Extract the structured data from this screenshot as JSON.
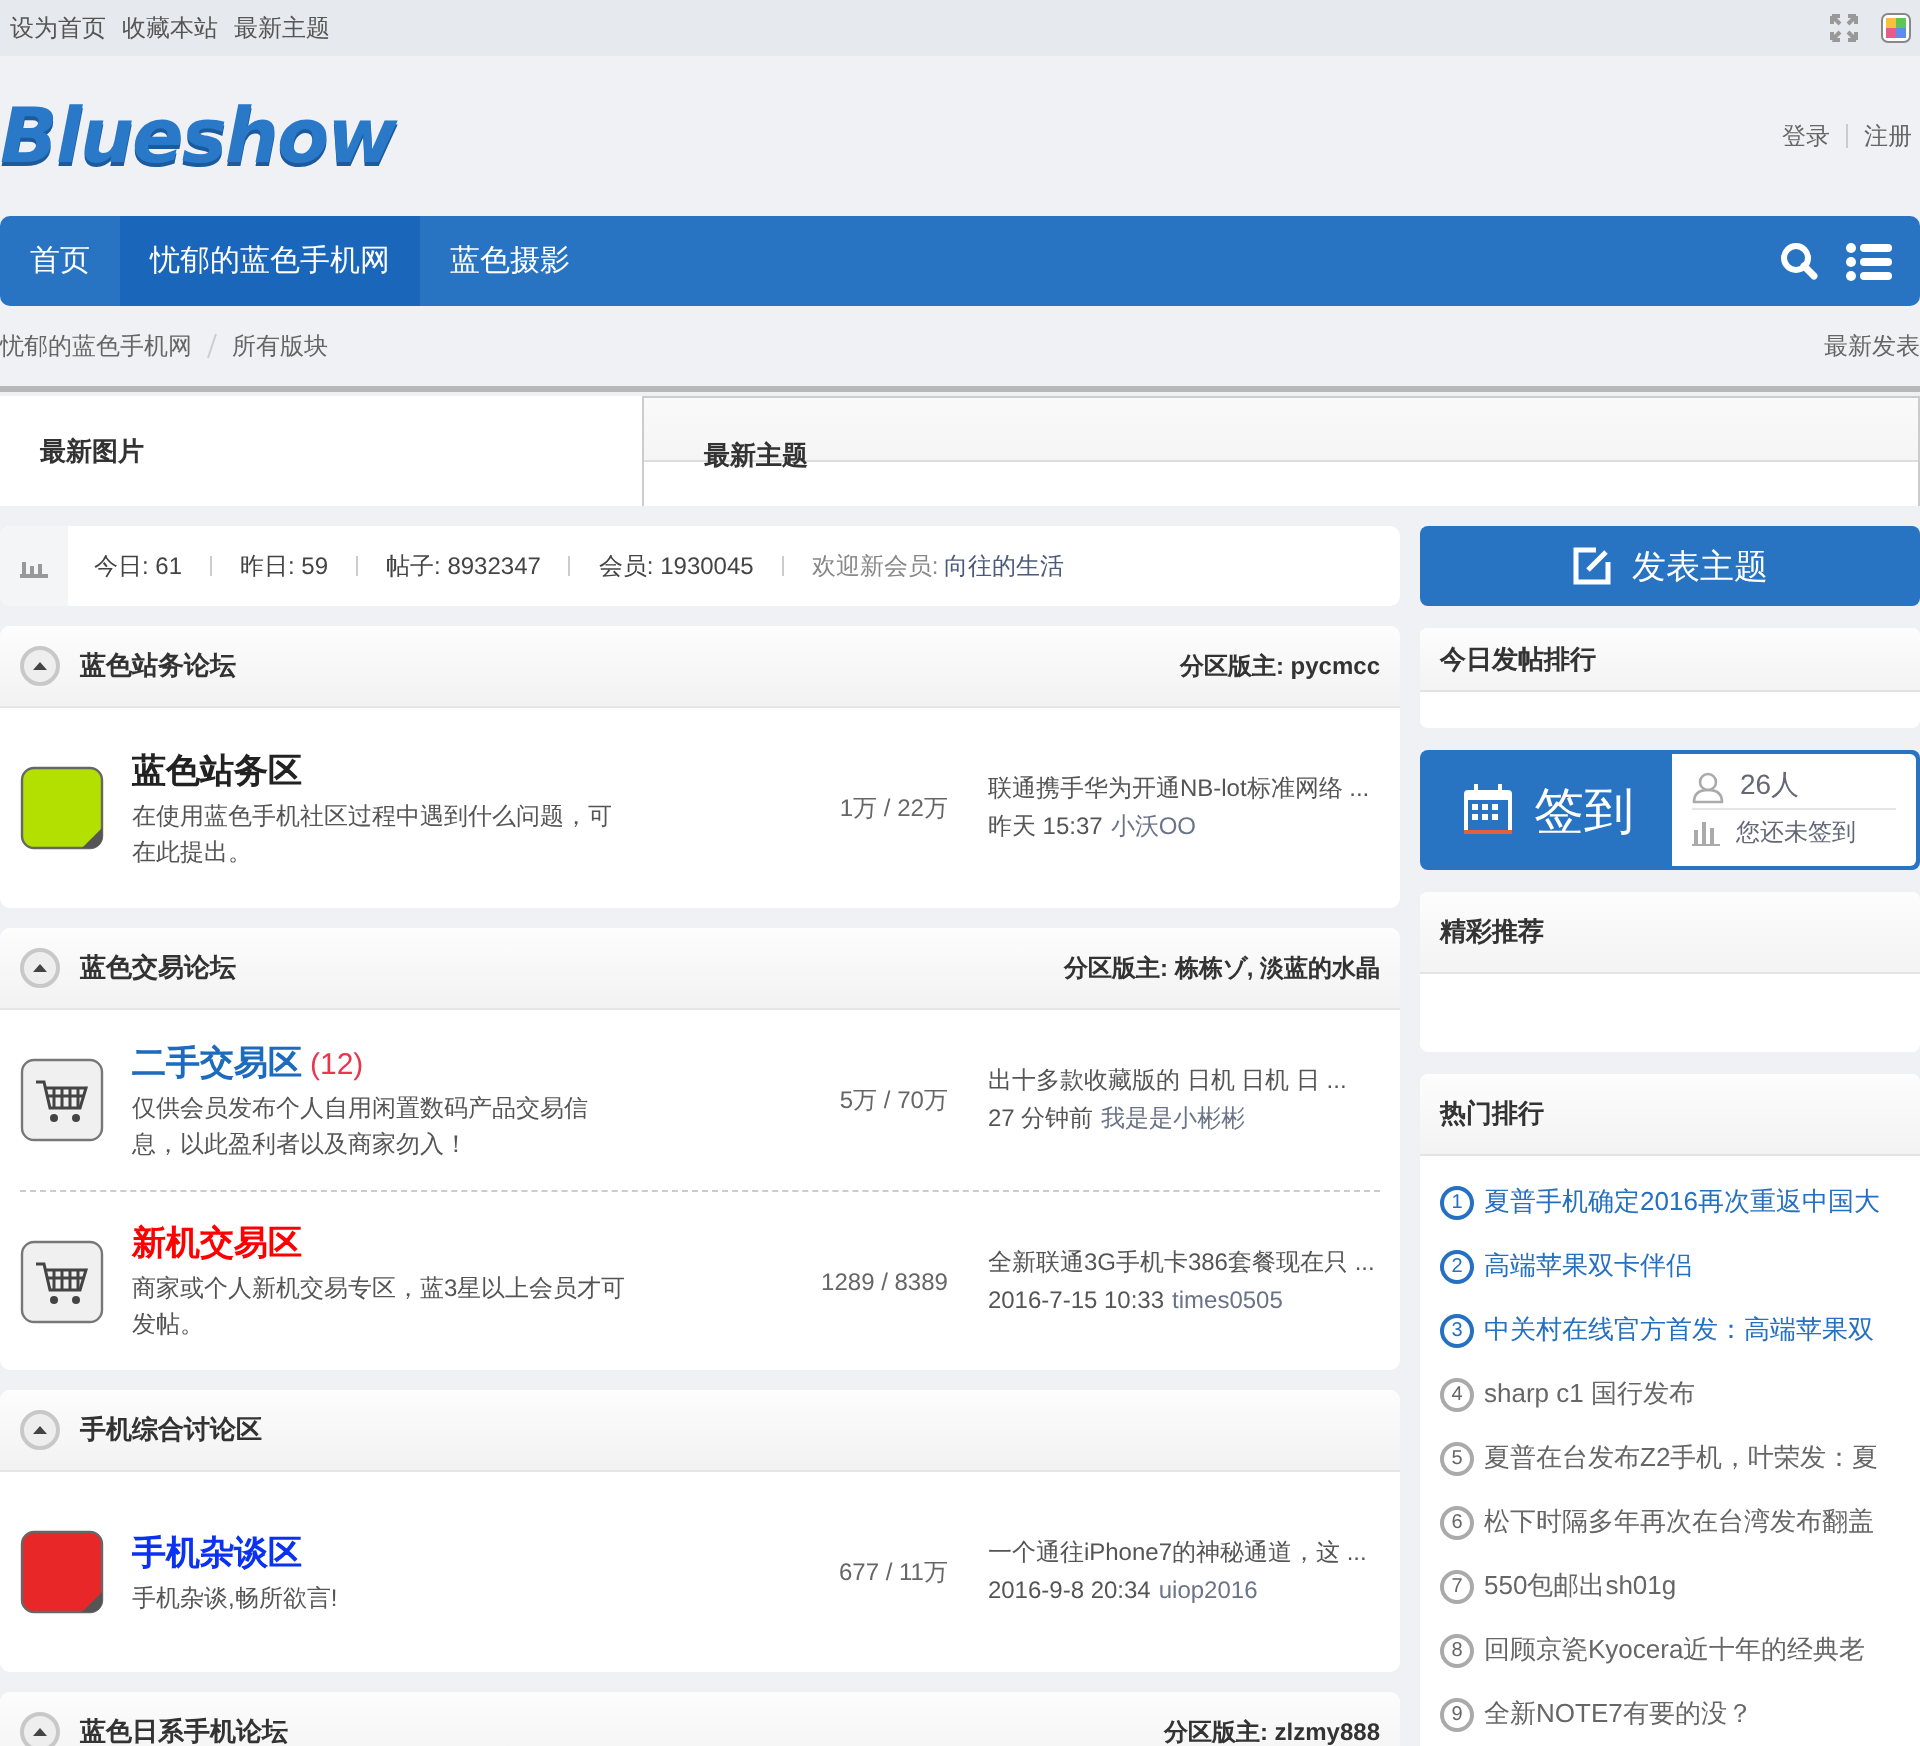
{
  "topbar": {
    "links": [
      "设为首页",
      "收藏本站",
      "最新主题"
    ]
  },
  "header": {
    "logo": "Blueshow",
    "account_links": [
      "登录",
      "注册"
    ]
  },
  "nav": {
    "items": [
      {
        "label": "首页",
        "selected": false
      },
      {
        "label": "忧郁的蓝色手机网",
        "selected": true
      },
      {
        "label": "蓝色摄影",
        "selected": false
      }
    ]
  },
  "breadcrumb": {
    "items": [
      "忧郁的蓝色手机网",
      "所有版块"
    ],
    "right_link": "最新发表"
  },
  "tabs": [
    {
      "label": "最新图片",
      "selected": true
    },
    {
      "label": "最新主题",
      "selected": false
    }
  ],
  "stats": {
    "items": [
      "今日: 61",
      "昨日: 59",
      "帖子: 8932347",
      "会员: 1930045"
    ],
    "welcome_label": "欢迎新会员:",
    "new_member": "向往的生活"
  },
  "sections": [
    {
      "title": "蓝色站务论坛",
      "moderator": "分区版主: pycmcc",
      "forums": [
        {
          "icon": {
            "kind": "note",
            "color": "#b4e000"
          },
          "name": "蓝色站务区",
          "color": "#222222",
          "description": "在使用蓝色手机社区过程中遇到什么问题，可在此提出。",
          "counts": "1万 / 22万",
          "last_title": "联通携手华为开通NB-lot标准网络 ...",
          "last_time": "昨天 15:37",
          "last_author": "小沃OO"
        }
      ]
    },
    {
      "title": "蓝色交易论坛",
      "moderator": "分区版主: 栋栋ゾ, 淡蓝的水晶",
      "forums": [
        {
          "icon": {
            "kind": "cart"
          },
          "name": "二手交易区",
          "color": "#1c6bbd",
          "new_count": "(12)",
          "description": "仅供会员发布个人自用闲置数码产品交易信息，以此盈利者以及商家勿入！",
          "counts": "5万 / 70万",
          "last_title": "出十多款收藏版的 日机 日机 日 ...",
          "last_time": "27 分钟前",
          "last_author": "我是是小彬彬"
        },
        {
          "icon": {
            "kind": "cart"
          },
          "name": "新机交易区",
          "color": "#ff0000",
          "description": "商家或个人新机交易专区，蓝3星以上会员才可发帖。",
          "counts": "1289 / 8389",
          "last_title": "全新联通3G手机卡386套餐现在只 ...",
          "last_time": "2016-7-15 10:33",
          "last_author": "times0505"
        }
      ]
    },
    {
      "title": "手机综合讨论区",
      "forums": [
        {
          "icon": {
            "kind": "note",
            "color": "#e82828"
          },
          "name": "手机杂谈区",
          "color": "#0a32f0",
          "description": "手机杂谈,畅所欲言!",
          "counts": "677 / 11万",
          "last_title": "一个通往iPhone7的神秘通道，这 ...",
          "last_time": "2016-9-8 20:34",
          "last_author": "uiop2016"
        }
      ]
    },
    {
      "title": "蓝色日系手机论坛",
      "moderator": "分区版主: zlzmy888"
    }
  ],
  "sidebar": {
    "post_button": "发表主题",
    "today_ranking": "今日发帖排行",
    "checkin": {
      "label": "签到",
      "count": "26人",
      "status": "您还未签到"
    },
    "featured": "精彩推荐",
    "hot_title": "热门排行",
    "hot": [
      {
        "rank": "1",
        "title": "夏普手机确定2016再次重返中国大",
        "highlighted": true
      },
      {
        "rank": "2",
        "title": "高端苹果双卡伴侣",
        "highlighted": true
      },
      {
        "rank": "3",
        "title": "中关村在线官方首发：高端苹果双",
        "highlighted": true
      },
      {
        "rank": "4",
        "title": "sharp c1 国行发布",
        "highlighted": false
      },
      {
        "rank": "5",
        "title": "夏普在台发布Z2手机，叶荣发：夏",
        "highlighted": false
      },
      {
        "rank": "6",
        "title": "松下时隔多年再次在台湾发布翻盖",
        "highlighted": false
      },
      {
        "rank": "7",
        "title": "550包邮出sh01g",
        "highlighted": false
      },
      {
        "rank": "8",
        "title": "回顾京瓷Kyocera近十年的经典老",
        "highlighted": false
      },
      {
        "rank": "9",
        "title": "全新NOTE7有要的没？",
        "highlighted": false
      }
    ]
  }
}
